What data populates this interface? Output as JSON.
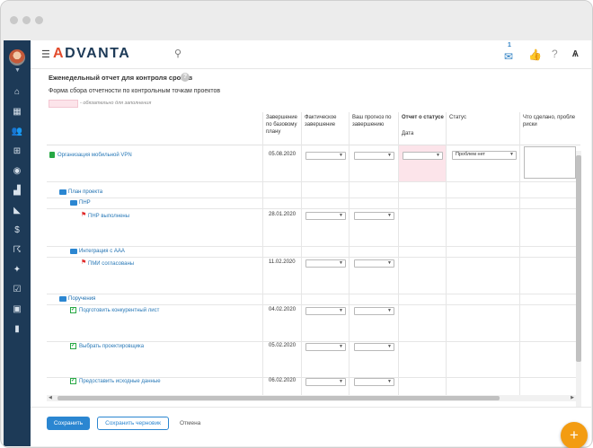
{
  "brand": {
    "logo_text": "ADVANTA"
  },
  "header": {
    "mail_count": "1"
  },
  "page": {
    "title": "Еженедельный отчет для контроля сроков",
    "help": "?",
    "subtitle": "Форма сбора отчетности по контрольным точкам проектов",
    "required_note": "- обязательно для заполнения"
  },
  "table": {
    "columns": {
      "planned": "Завершение по базовому плану",
      "actual": "Фактическое завершение",
      "forecast": "Ваш прогноз по завершению",
      "status_report": "Отчет о статусе",
      "status_report_sub": "Дата",
      "status": "Статус",
      "done": "Что сделано, пробле риски"
    },
    "rows": {
      "r1": {
        "name": "Организация мобильной VPN",
        "date": "05.08.2020",
        "status_value": "Проблем нет"
      },
      "r2": {
        "name": "План проекта"
      },
      "r3": {
        "name": "ПНР"
      },
      "r4": {
        "name": "ПНР выполнены",
        "date": "28.01.2020"
      },
      "r5": {
        "name": "Интеграция с ААА"
      },
      "r6": {
        "name": "ПМИ согласованы",
        "date": "11.02.2020"
      },
      "r7": {
        "name": "Поручения"
      },
      "r8": {
        "name": "Подготовить конкурентный лист",
        "date": "04.02.2020"
      },
      "r9": {
        "name": "Выбрать проектировщика",
        "date": "05.02.2020"
      },
      "r10": {
        "name": "Предоставить исходные данные",
        "date": "06.02.2020"
      }
    }
  },
  "footer": {
    "save_label": "Сохранить",
    "draft_label": "Сохранить черновик",
    "cancel_label": "Отмена"
  },
  "colors": {
    "accent": "#2b86d1",
    "sidebar": "#1d3a57",
    "fab": "#f39c12",
    "required": "#fce4ea"
  }
}
